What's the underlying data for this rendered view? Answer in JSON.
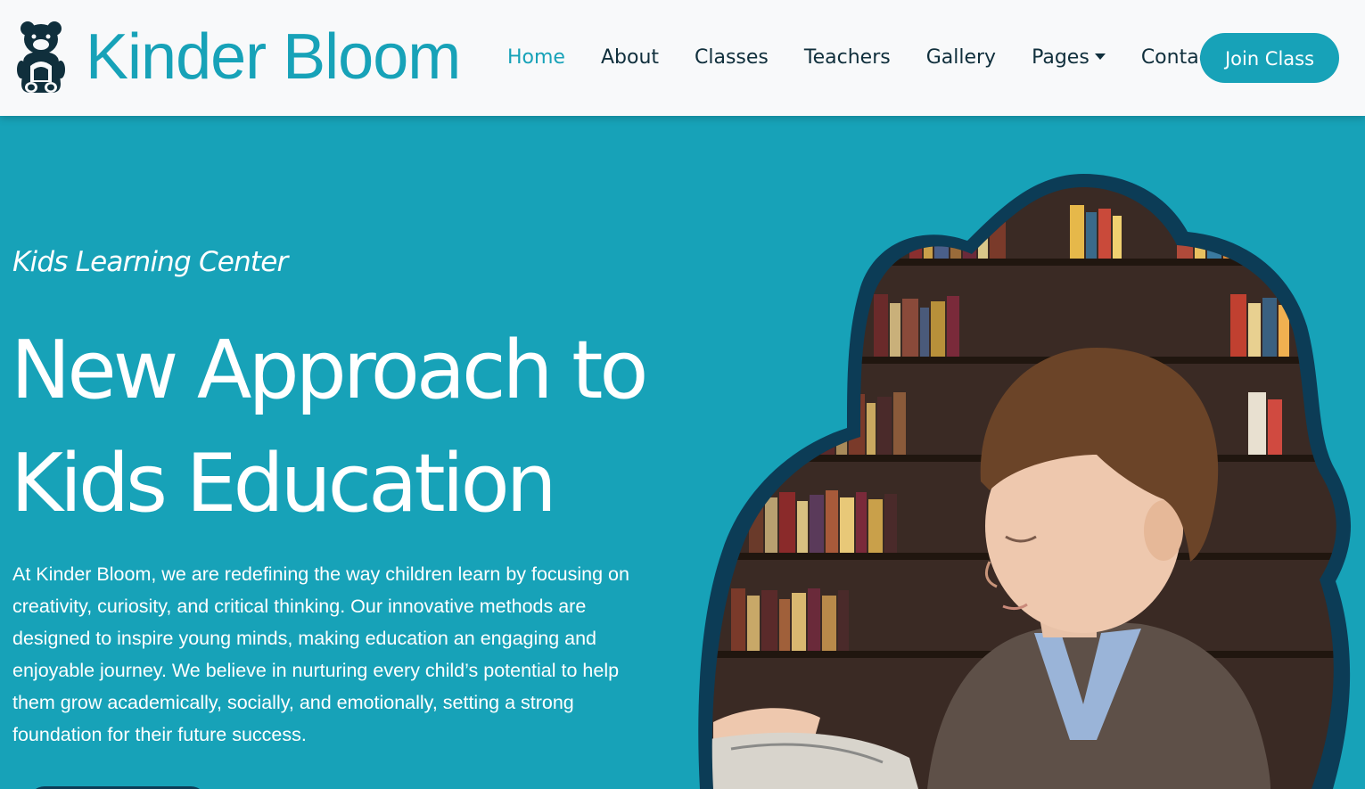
{
  "brand": {
    "name": "Kinder Bloom",
    "logo_icon": "teddy-bear-icon",
    "accent_color": "#17a2b8",
    "dark_color": "#102f3c"
  },
  "nav": {
    "items": [
      {
        "label": "Home",
        "active": true
      },
      {
        "label": "About"
      },
      {
        "label": "Classes"
      },
      {
        "label": "Teachers"
      },
      {
        "label": "Gallery"
      },
      {
        "label": "Pages",
        "dropdown": true
      },
      {
        "label": "Contact"
      }
    ],
    "cta_label": "Join Class"
  },
  "hero": {
    "subtitle": "Kids Learning Center",
    "headline": "New Approach to Kids Education",
    "description": "At Kinder Bloom, we are redefining the way children learn by focusing on creativity, curiosity, and critical thinking. Our innovative methods are designed to inspire young minds, making education an engaging and enjoyable journey. We believe in nurturing every child’s potential to help them grow academically, socially, and emotionally, setting a strong foundation for their future success.",
    "image_icon": "boy-reading-book-photo",
    "background_color": "#17a2b8",
    "frame_color": "#0c3c56"
  }
}
